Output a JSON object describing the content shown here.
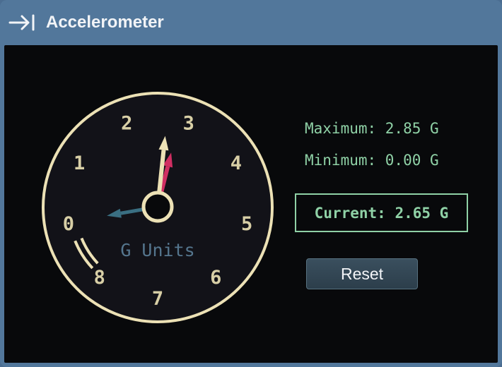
{
  "window": {
    "title": "Accelerometer",
    "title_icon": "collapse-right-arrow-icon"
  },
  "gauge": {
    "dial_labels": [
      "0",
      "1",
      "2",
      "3",
      "4",
      "5",
      "6",
      "7",
      "8"
    ],
    "unit_label": "G Units",
    "current_value": 2.65,
    "maximum_value": 2.85,
    "minimum_value": 0.0,
    "scale_min": 0,
    "scale_max": 8,
    "colors": {
      "face": "#121218",
      "rim": "#ece1b5",
      "numbers": "#d8cfa6",
      "unit_label": "#55768e",
      "current_needle": "#ece1b5",
      "max_needle": "#d02e62",
      "min_needle": "#3a6f82"
    }
  },
  "stats": {
    "maximum": "Maximum: 2.85 G",
    "minimum": "Minimum: 0.00 G",
    "current": "Current: 2.65 G"
  },
  "reset_button": {
    "label": "Reset"
  },
  "colors": {
    "titlebar": "#52779b",
    "panel_bg": "#08090b",
    "stat_text": "#8fd1a6"
  }
}
